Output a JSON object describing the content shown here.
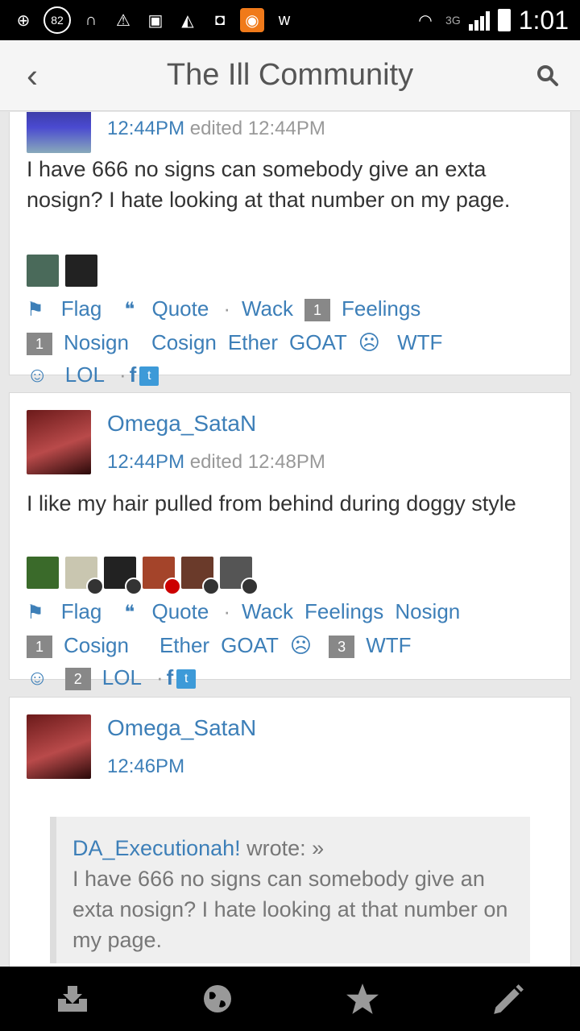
{
  "status_bar": {
    "battery_level": "82",
    "network": "3G",
    "time": "1:01"
  },
  "app_bar": {
    "title": "The Ill Community"
  },
  "posts": [
    {
      "time": "12:44PM",
      "edited": "edited 12:44PM",
      "text": "I have 666 no signs can somebody give an exta nosign? I hate looking at that number on my page.",
      "actions": {
        "flag": "Flag",
        "quote": "Quote",
        "wack": "Wack",
        "feelings_count": "1",
        "feelings": "Feelings",
        "nosign_count": "1",
        "nosign": "Nosign",
        "cosign": "Cosign",
        "ether": "Ether",
        "goat": "GOAT",
        "wtf": "WTF",
        "lol": "LOL"
      }
    },
    {
      "username": "Omega_SataN",
      "time": "12:44PM",
      "edited": "edited 12:48PM",
      "text": "I like my hair pulled from behind during doggy style",
      "actions": {
        "flag": "Flag",
        "quote": "Quote",
        "wack": "Wack",
        "feelings": "Feelings",
        "nosign": "Nosign",
        "cosign_count": "1",
        "cosign": "Cosign",
        "ether": "Ether",
        "goat": "GOAT",
        "wtf_count": "3",
        "wtf": "WTF",
        "lol_count": "2",
        "lol": "LOL"
      }
    },
    {
      "username": "Omega_SataN",
      "time": "12:46PM",
      "quote": {
        "author": "DA_Executionah!",
        "wrote": "wrote: »",
        "text": "I have 666 no signs can somebody give an exta nosign? I hate looking at that number on my page."
      }
    }
  ],
  "colors": {
    "link": "#3d7fb8",
    "background": "#e8e8e8",
    "card": "#ffffff"
  }
}
